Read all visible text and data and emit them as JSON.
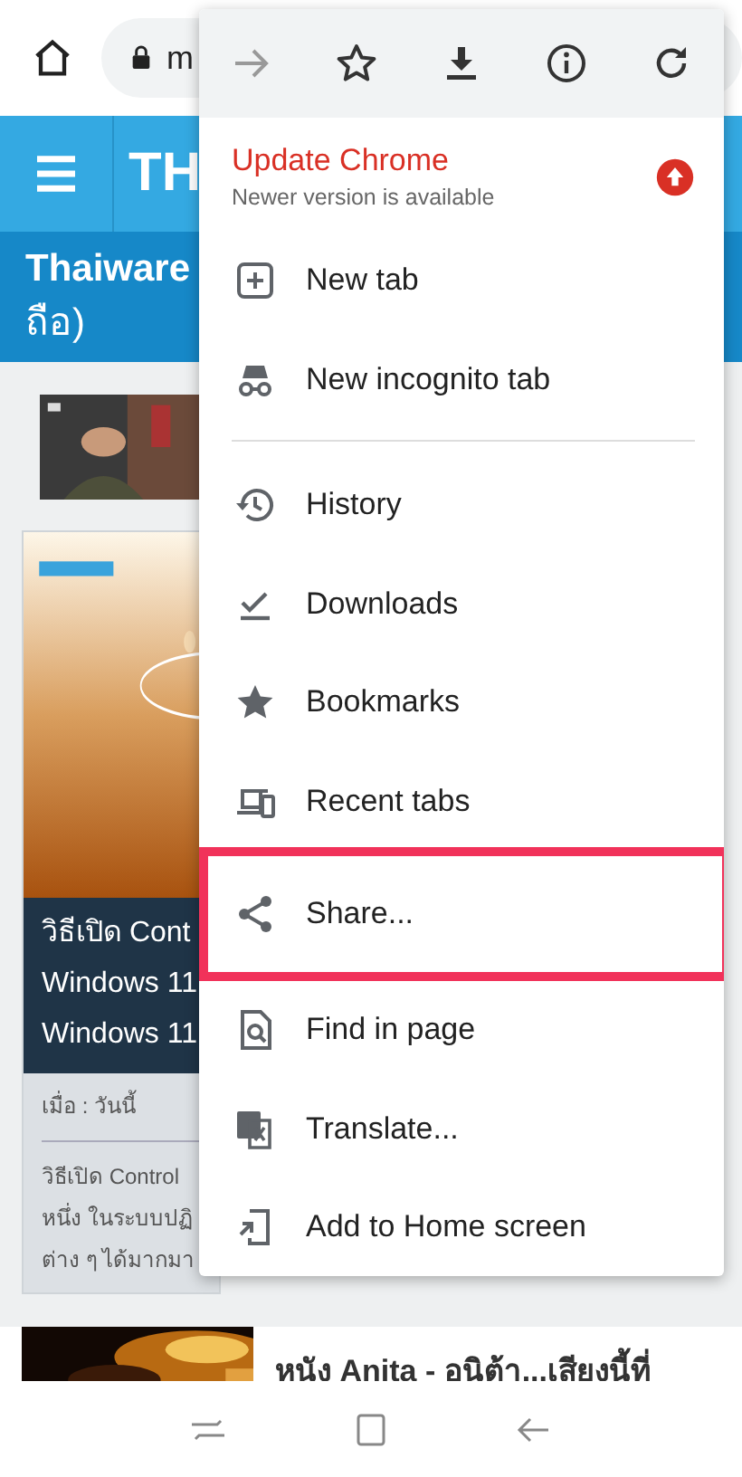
{
  "browser_bar": {
    "url": "m"
  },
  "site_header": {
    "logo": "TH"
  },
  "article_title": [
    "Thaiware",
    "ถือ)"
  ],
  "featured": {
    "headline": [
      "วิธีเปิด Cont",
      "Windows 11",
      "Windows 11"
    ],
    "date": "เมื่อ : วันนี้",
    "excerpt": [
      "วิธีเปิด Control",
      "หนึ่ง ในระบบปฏิ",
      "ต่าง ๆ ได้มากมา"
    ]
  },
  "next_article": {
    "title": "หนัง Anita - อนิต้า...เสียงนี้ที่"
  },
  "menu": {
    "toolbar": [
      {
        "disabled": true
      },
      {
        "disabled": false
      },
      {
        "disabled": false
      },
      {
        "disabled": false
      },
      {
        "disabled": false
      }
    ],
    "update": {
      "title": "Update Chrome",
      "subtitle": "Newer version is available"
    },
    "items": [
      {
        "kind": "item",
        "label": "New tab",
        "highlighted": false
      },
      {
        "kind": "item",
        "label": "New incognito tab",
        "highlighted": false
      },
      {
        "kind": "divider"
      },
      {
        "kind": "item",
        "label": "History",
        "highlighted": false
      },
      {
        "kind": "item",
        "label": "Downloads",
        "highlighted": false
      },
      {
        "kind": "item",
        "label": "Bookmarks",
        "highlighted": false
      },
      {
        "kind": "item",
        "label": "Recent tabs",
        "highlighted": false
      },
      {
        "kind": "item",
        "label": "Share...",
        "highlighted": true
      },
      {
        "kind": "item",
        "label": "Find in page",
        "highlighted": false
      },
      {
        "kind": "item",
        "label": "Translate...",
        "highlighted": false
      },
      {
        "kind": "item",
        "label": "Add to Home screen",
        "highlighted": false
      }
    ]
  }
}
